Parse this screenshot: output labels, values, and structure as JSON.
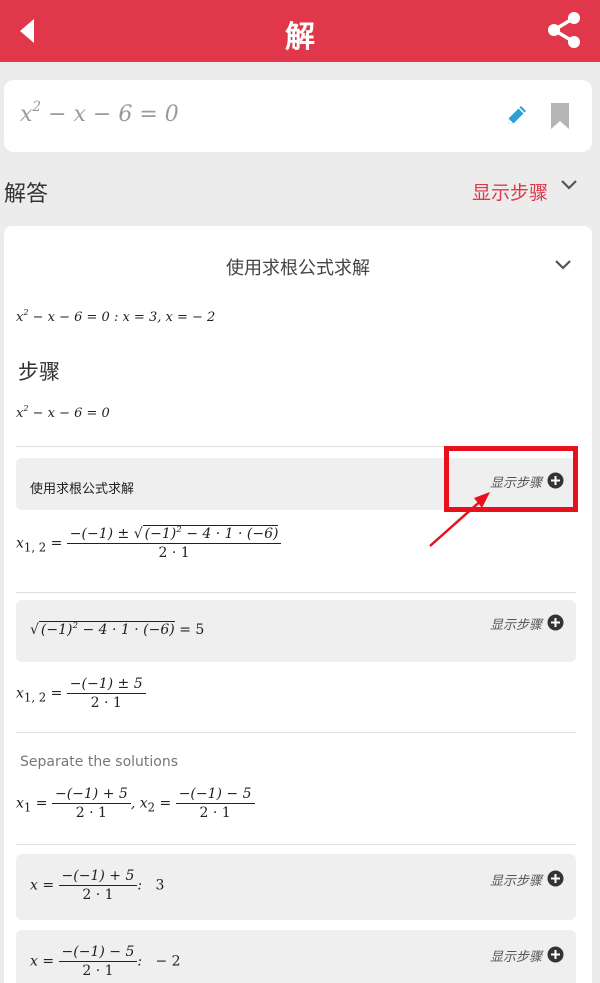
{
  "header": {
    "title": "解",
    "back_icon": "back-arrow-icon",
    "share_icon": "share-icon"
  },
  "input": {
    "equation_base": "x",
    "equation_exp": "2",
    "equation_rest": "− x − 6 = 0"
  },
  "answer": {
    "label": "解答",
    "show_steps": "显示步骤"
  },
  "solution": {
    "method_title": "使用求根公式求解",
    "summary_base": "x",
    "summary_exp": "2",
    "summary_rest": "− x − 6 = 0    :    x = 3, x = − 2",
    "steps_title": "步骤",
    "steps_eq_base": "x",
    "steps_eq_exp": "2",
    "steps_eq_rest": "− x − 6 = 0",
    "step1_label": "使用求根公式求解",
    "show_steps": "显示步骤",
    "formula_lhs": "x",
    "formula_lhs_sub": "1, 2",
    "formula_num_pre": "−(−1) ± ",
    "formula_sqrt_a": "(−1)",
    "formula_sqrt_exp": "2",
    "formula_sqrt_b": " − 4 · 1 · (−6)",
    "formula_den": "2 · 1",
    "sqrt_a": "(−1)",
    "sqrt_exp": "2",
    "sqrt_b": " − 4 · 1 · (−6)",
    "sqrt_result": "= 5",
    "x12_num": "−(−1) ± 5",
    "x12_den": "2 · 1",
    "separate_label": "Separate the solutions",
    "x1_lhs": "x",
    "x1_sub": "1",
    "x1_num": "−(−1) + 5",
    "x1_den": "2 · 1",
    "x2_lhs": "x",
    "x2_sub": "2",
    "x2_num": "−(−1) − 5",
    "x2_den": "2 · 1",
    "r1_num": "−(−1) + 5",
    "r1_den": "2 · 1",
    "r1_value": "3",
    "r2_num": "−(−1) − 5",
    "r2_den": "2 · 1",
    "r2_value": "− 2"
  },
  "colors": {
    "brand": "#e0384a",
    "highlight": "#e8101c",
    "pencil": "#2a9fd8"
  }
}
